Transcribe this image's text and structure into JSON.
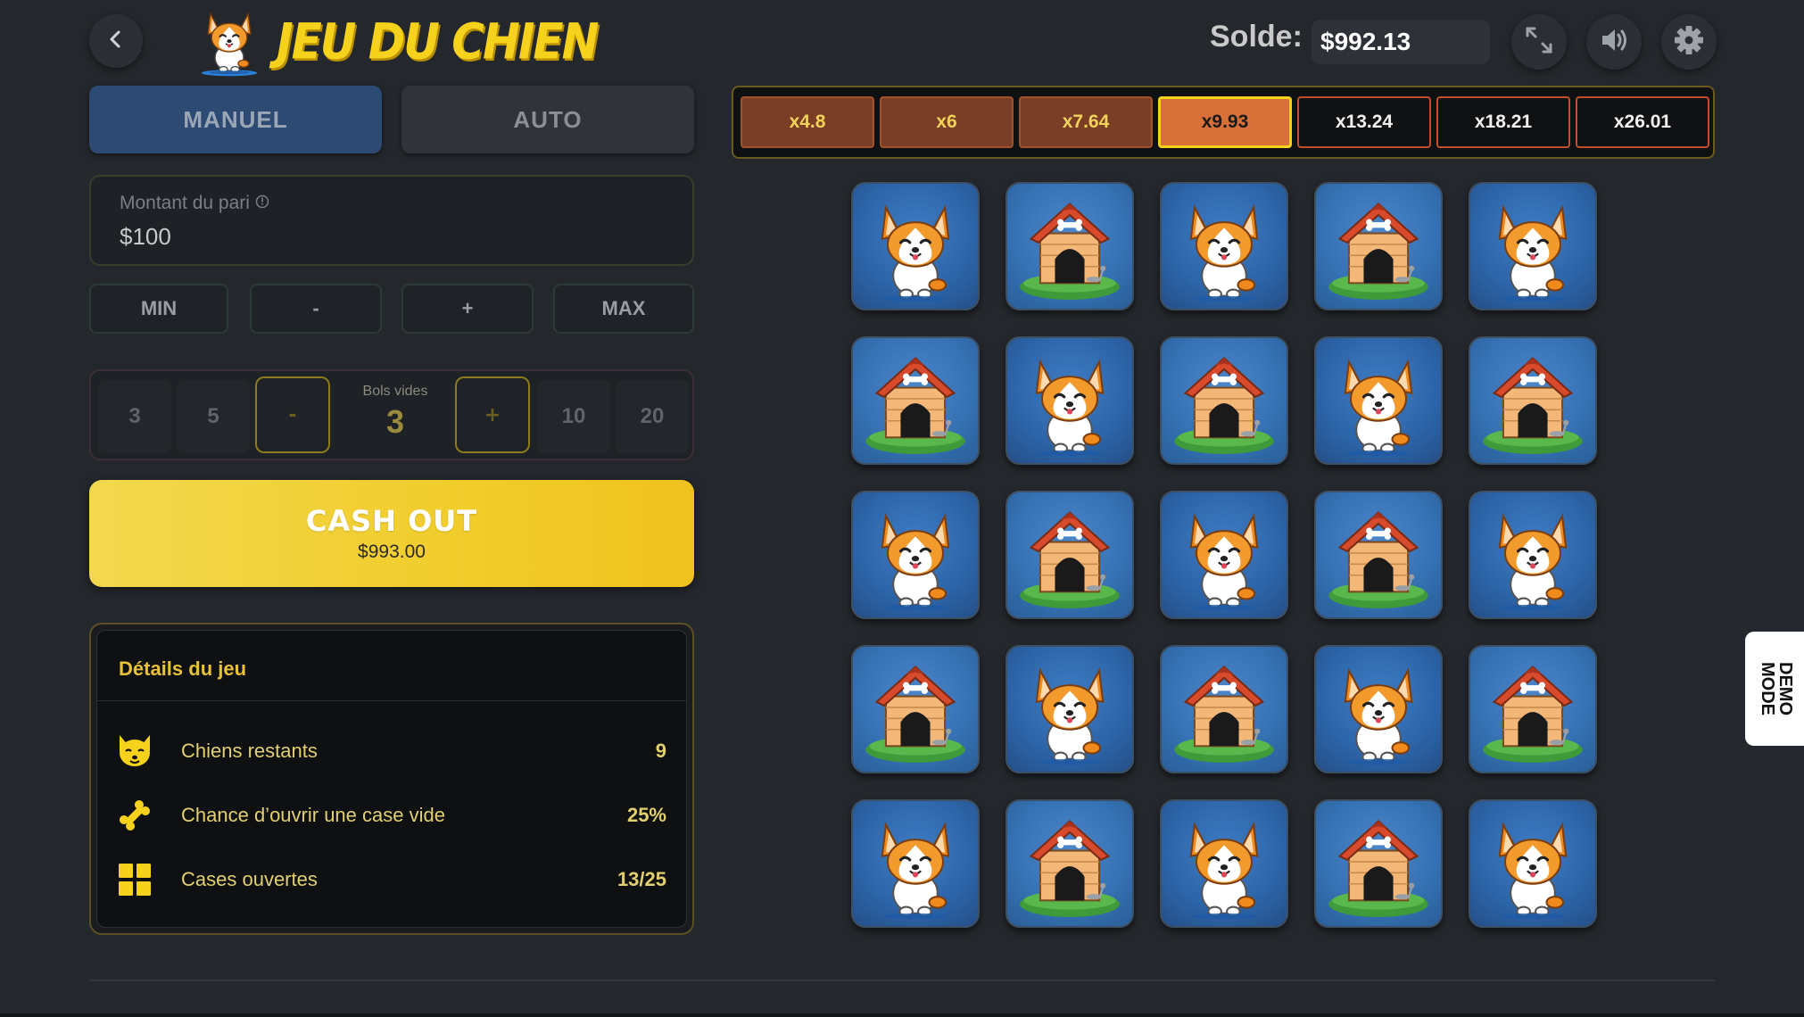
{
  "header": {
    "title": "JEU DU CHIEN",
    "balance_label": "Solde:",
    "balance_value": "$992.13",
    "icons": [
      "back-icon",
      "fullscreen-icon",
      "sound-icon",
      "settings-icon"
    ]
  },
  "tabs": {
    "manual": "MANUEL",
    "auto": "AUTO",
    "active": "manual"
  },
  "bet": {
    "label": "Montant du pari",
    "value": "$100",
    "buttons": {
      "min": "MIN",
      "minus": "-",
      "plus": "+",
      "max": "MAX"
    }
  },
  "bowls": {
    "options_left": [
      "3",
      "5"
    ],
    "decrement": "-",
    "center_label": "Bols vides",
    "center_value": "3",
    "increment": "+",
    "options_right": [
      "10",
      "20"
    ]
  },
  "cashout": {
    "title": "CASH OUT",
    "amount": "$993.00"
  },
  "details": {
    "title": "Détails du jeu",
    "rows": [
      {
        "icon": "dog-face-icon",
        "label": "Chiens restants",
        "value": "9"
      },
      {
        "icon": "bone-icon",
        "label": "Chance d’ouvrir une case vide",
        "value": "25%"
      },
      {
        "icon": "grid-icon",
        "label": "Cases ouvertes",
        "value": "13/25"
      }
    ]
  },
  "multipliers": [
    {
      "label": "x4.8",
      "state": "past"
    },
    {
      "label": "x6",
      "state": "past"
    },
    {
      "label": "x7.64",
      "state": "past"
    },
    {
      "label": "x9.93",
      "state": "current"
    },
    {
      "label": "x13.24",
      "state": "future"
    },
    {
      "label": "x18.21",
      "state": "future"
    },
    {
      "label": "x26.01",
      "state": "future"
    }
  ],
  "grid": [
    [
      "dog",
      "house",
      "dog",
      "house",
      "dog"
    ],
    [
      "house",
      "dog",
      "house",
      "dog",
      "house"
    ],
    [
      "dog",
      "house",
      "dog",
      "house",
      "dog"
    ],
    [
      "house",
      "dog",
      "house",
      "dog",
      "house"
    ],
    [
      "dog",
      "house",
      "dog",
      "house",
      "dog"
    ]
  ],
  "demo_badge": "DEMO\nMODE",
  "colors": {
    "accent_yellow": "#f6d21c",
    "tile_blue": "#2c64a8",
    "background": "#24272c",
    "multiplier_current": "#d8703a"
  }
}
